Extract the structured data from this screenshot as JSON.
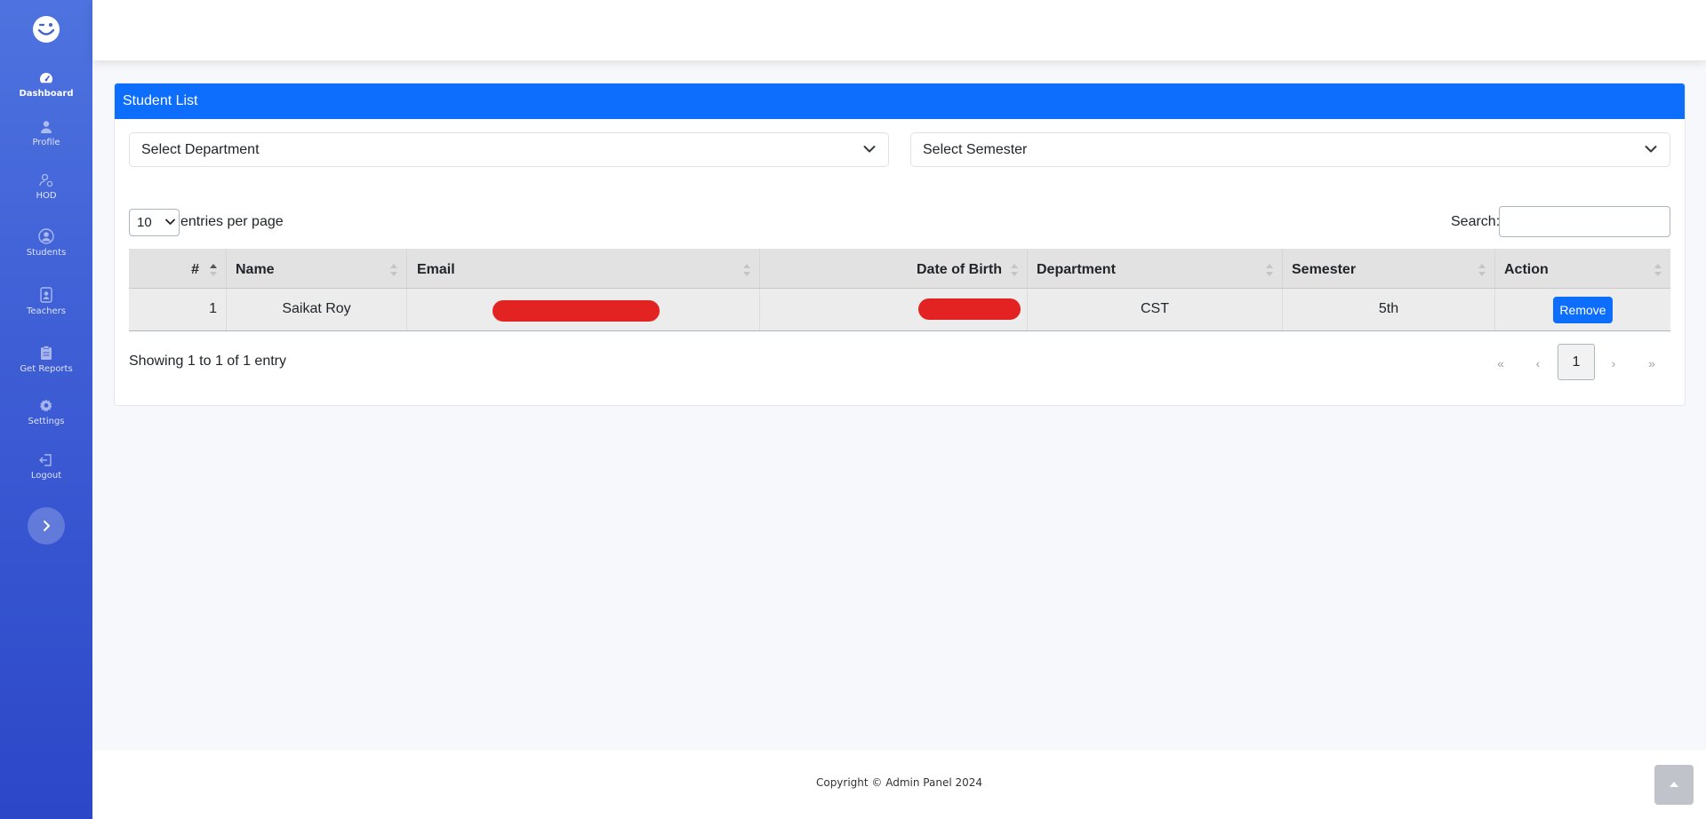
{
  "sidebar": {
    "logo": "winking-face-icon",
    "items": [
      {
        "label": "Dashboard",
        "icon": "speedometer-icon",
        "active": true
      },
      {
        "label": "Profile",
        "icon": "person-icon"
      },
      {
        "label": "HOD",
        "icon": "person-gear-icon"
      },
      {
        "label": "Students",
        "icon": "person-circle-icon"
      },
      {
        "label": "Teachers",
        "icon": "person-badge-icon"
      },
      {
        "label": "Get Reports",
        "icon": "clipboard-icon"
      },
      {
        "label": "Settings",
        "icon": "gear-icon"
      },
      {
        "label": "Logout",
        "icon": "logout-icon"
      }
    ],
    "toggle_icon": "chevron-right-icon"
  },
  "card": {
    "title": "Student List"
  },
  "filters": {
    "department": "Select Department",
    "semester": "Select Semester"
  },
  "table_controls": {
    "page_length": "10",
    "length_label": "entries per page",
    "search_label": "Search:",
    "search_value": ""
  },
  "table": {
    "columns": [
      "#",
      "Name",
      "Email",
      "Date of Birth",
      "Department",
      "Semester",
      "Action"
    ],
    "rows": [
      {
        "index": "1",
        "name": "Saikat Roy",
        "email": "[redacted]",
        "dob": "[redacted]",
        "department": "CST",
        "semester": "5th",
        "action": "Remove"
      }
    ]
  },
  "pagination": {
    "info": "Showing 1 to 1 of 1 entry",
    "first": "«",
    "prev": "‹",
    "current": "1",
    "next": "›",
    "last": "»"
  },
  "footer": {
    "copyright": "Copyright © Admin Panel 2024"
  },
  "colors": {
    "sidebar_top": "#4e73df",
    "sidebar_bottom": "#2c47c8",
    "primary": "#0d6efd",
    "redaction": "#e32222"
  }
}
